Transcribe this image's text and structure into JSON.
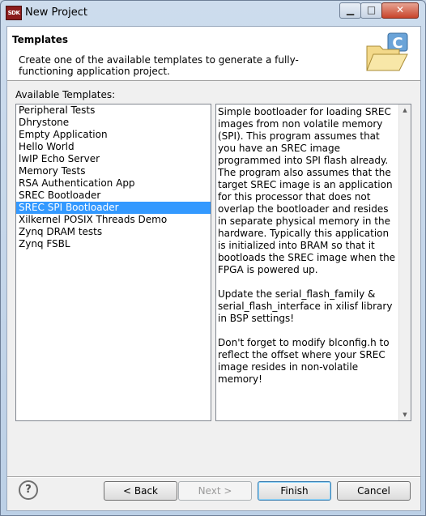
{
  "window": {
    "title": "New Project",
    "app_icon_text": "SDK"
  },
  "header": {
    "title": "Templates",
    "description": "Create one of the available templates to generate a fully-functioning application project."
  },
  "available_label": "Available Templates:",
  "templates": [
    "Peripheral Tests",
    "Dhrystone",
    "Empty Application",
    "Hello World",
    "lwIP Echo Server",
    "Memory Tests",
    "RSA Authentication App",
    "SREC Bootloader",
    "SREC SPI Bootloader",
    "Xilkernel POSIX Threads Demo",
    "Zynq DRAM tests",
    "Zynq FSBL"
  ],
  "selected_index": 8,
  "description": "Simple bootloader for loading SREC images from non volatile memory (SPI). This program assumes that you have an SREC image programmed into SPI flash already. The program also assumes that the target SREC image is an application for this processor that does not overlap the bootloader and resides in separate physical memory in the hardware. Typically this application is initialized into BRAM so that it bootloads the SREC image when the FPGA is powered up.\n\nUpdate the serial_flash_family & serial_flash_interface in xilisf library in BSP settings!\n\nDon't forget to modify blconfig.h to reflect the offset where your SREC image resides in non-volatile memory!",
  "buttons": {
    "back": "< Back",
    "next": "Next >",
    "finish": "Finish",
    "cancel": "Cancel"
  },
  "icons": {
    "help": "help-icon",
    "folder": "folder-icon"
  }
}
